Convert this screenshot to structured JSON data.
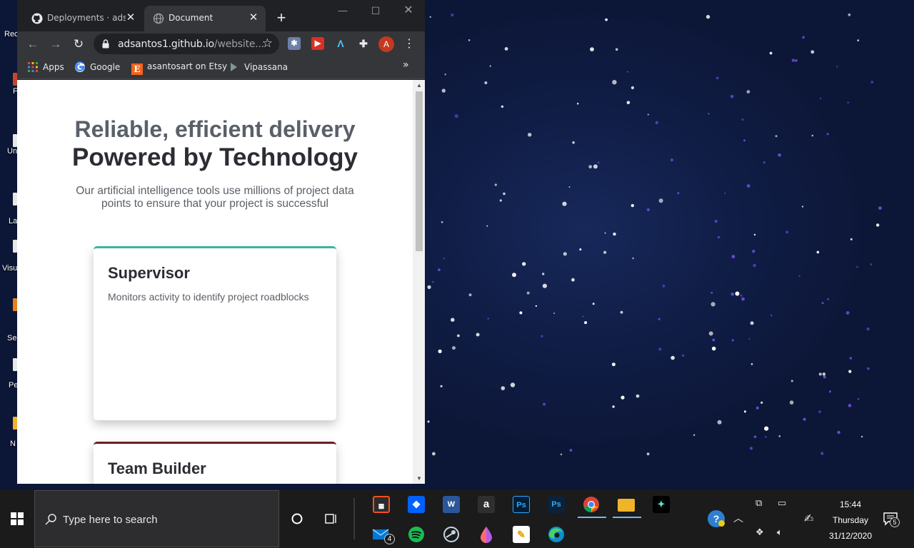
{
  "browser": {
    "tabs": [
      {
        "title": "Deployments · adsa",
        "icon": "github-icon",
        "active": false
      },
      {
        "title": "Document",
        "icon": "globe-icon",
        "active": true
      }
    ],
    "url_host": "adsantos1.github.io",
    "url_path": "/website...",
    "profile_initial": "A",
    "bookmarks": [
      {
        "label": "Apps",
        "icon": "apps-grid-icon"
      },
      {
        "label": "Google",
        "icon": "google-icon"
      },
      {
        "label": "asantosart on Etsy",
        "icon": "etsy-icon"
      },
      {
        "label": "Vipassana",
        "icon": "vipassana-leaf-icon"
      }
    ],
    "extensions": [
      "puzzle-color-icon",
      "red-square-icon",
      "blue-a-icon",
      "extensions-puzzle-icon"
    ]
  },
  "page": {
    "hero_line1": "Reliable, efficient delivery",
    "hero_line2": "Powered by Technology",
    "hero_subtitle": "Our artificial intelligence tools use millions of project data points to ensure that your project is successful",
    "cards": [
      {
        "title": "Supervisor",
        "description": "Monitors activity to identify project roadblocks",
        "accent": "#3eb2a2"
      },
      {
        "title": "Team Builder",
        "description": "",
        "accent": "#6b1e23"
      }
    ]
  },
  "desktop": {
    "icon_labels": [
      "Rec",
      "F",
      "Un",
      "La",
      "Visu",
      "Se",
      "Pe",
      "N"
    ]
  },
  "taskbar": {
    "search_placeholder": "Type here to search",
    "mail_badge": "4",
    "notification_badge": "5",
    "clock_time": "15:44",
    "clock_day": "Thursday",
    "clock_date": "31/12/2020"
  },
  "colors": {
    "desktop_bg": "#0e1a3c",
    "chrome_dark": "#202124",
    "chrome_toolbar": "#35363a",
    "taskbar": "#1b1b1c",
    "accent_blue": "#76b9ed"
  }
}
